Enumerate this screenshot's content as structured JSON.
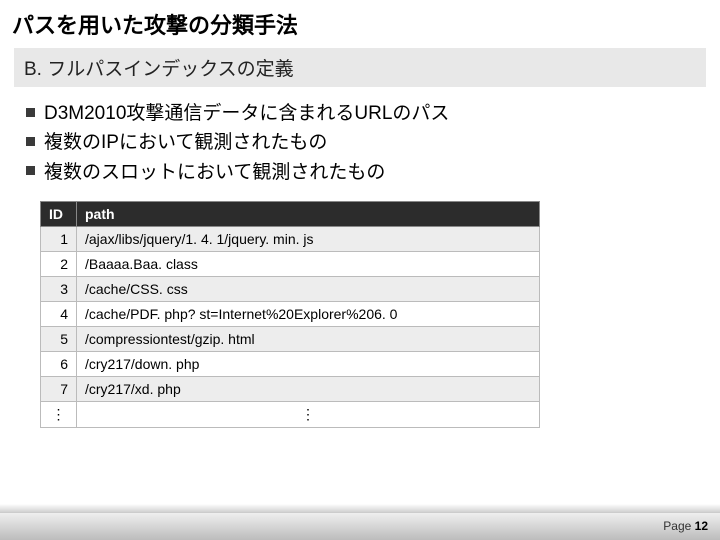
{
  "title": "パスを用いた攻撃の分類手法",
  "section": "B. フルパスインデックスの定義",
  "bullets": [
    "D3M2010攻撃通信データに含まれるURLのパス",
    "複数のIPにおいて観測されたもの",
    "複数のスロットにおいて観測されたもの"
  ],
  "table": {
    "headers": {
      "id": "ID",
      "path": "path"
    },
    "rows": [
      {
        "id": "1",
        "path": "/ajax/libs/jquery/1. 4. 1/jquery. min. js"
      },
      {
        "id": "2",
        "path": "/Baaaa.Baa. class"
      },
      {
        "id": "3",
        "path": "/cache/CSS. css"
      },
      {
        "id": "4",
        "path": "/cache/PDF. php? st=Internet%20Explorer%206. 0"
      },
      {
        "id": "5",
        "path": "/compressiontest/gzip. html"
      },
      {
        "id": "6",
        "path": "/cry217/down. php"
      },
      {
        "id": "7",
        "path": "/cry217/xd. php"
      }
    ],
    "ellipsis_id": "⋮",
    "ellipsis_path": "⋮"
  },
  "footer": {
    "page_label": "Page ",
    "page_number": "12"
  }
}
